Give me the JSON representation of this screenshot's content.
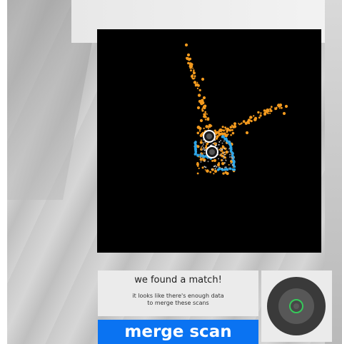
{
  "scan_map": {
    "background_color": "#000000",
    "scan_a_color": "#f39a1e",
    "scan_b_color": "#2ea6e8",
    "marker_color": "#ffffff"
  },
  "match_card": {
    "title": "we found a match!",
    "description_line1": "it looks like there's enough data",
    "description_line2": "to merge these scans"
  },
  "merge_button": {
    "label": "merge scan",
    "color": "#0a73f2"
  },
  "shutter": {
    "ring_color": "#36c95a",
    "icon": "capture-icon"
  }
}
